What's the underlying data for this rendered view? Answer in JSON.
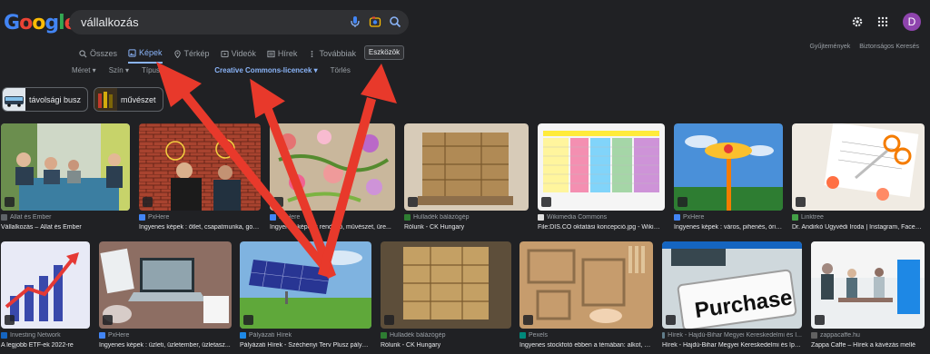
{
  "logo": {
    "text": "Google"
  },
  "search": {
    "query": "vállalkozás"
  },
  "account": {
    "initial": "D"
  },
  "tabs": [
    {
      "label": "Összes",
      "icon": "search-icon"
    },
    {
      "label": "Képek",
      "icon": "image-icon",
      "active": true
    },
    {
      "label": "Térkép",
      "icon": "map-pin-icon"
    },
    {
      "label": "Videók",
      "icon": "video-icon"
    },
    {
      "label": "Hírek",
      "icon": "news-icon"
    },
    {
      "label": "Továbbiak",
      "icon": "more-icon"
    }
  ],
  "tools_label": "Eszközök",
  "right_links": {
    "collections": "Gyűjtemények",
    "safe_search": "Biztonságos Keresés"
  },
  "filters": {
    "size": "Méret",
    "color": "Szín",
    "type": "Típus",
    "license": "Creative Commons-licencek",
    "clear": "Törlés"
  },
  "chips": [
    {
      "label": "távolsági busz"
    },
    {
      "label": "művészet"
    }
  ],
  "results_row1": [
    {
      "source": "Állat és Ember",
      "title": "Vállalkozás – Állat és Ember"
    },
    {
      "source": "PxHere",
      "title": "Ingyenes képek : ötlet, csapatmunka, gon..."
    },
    {
      "source": "PxHere",
      "title": "Ingyenes képek : rendező, művészet, üre..."
    },
    {
      "source": "Hulladék bálázógép",
      "title": "Rólunk - CK Hungary"
    },
    {
      "source": "Wikimedia Commons",
      "title": "File:DIS.CO oktatási koncepció.jpg - Wikime..."
    },
    {
      "source": "PxHere",
      "title": "Ingyenes képek : város, pihenés, óriá..."
    },
    {
      "source": "Linktree",
      "title": "Dr. Andirkó Ügyvédi Iroda | Instagram, Facebo..."
    }
  ],
  "results_row2": [
    {
      "source": "Investing Network",
      "title": "A legjobb ETF-ek 2022-re"
    },
    {
      "source": "PxHere",
      "title": "Ingyenes képek : üzleti, üzletember, üzletasz..."
    },
    {
      "source": "Pályázati Hírek",
      "title": "Pályázati Hírek - Széchenyi Terv Plusz pályáz..."
    },
    {
      "source": "Hulladék bálázógép",
      "title": "Rólunk - CK Hungary"
    },
    {
      "source": "Pexels",
      "title": "Ingyenes stockfotó ebben a témában: alkot, a..."
    },
    {
      "source": "Hírek - Hajdú-Bihar Megyei Kereskedelmi és I...",
      "title": "Hírek - Hajdú-Bihar Megyei Kereskedelmi és Ipar..."
    },
    {
      "source": "zappacaffe.hu",
      "title": "Zappa Caffe – Hírek a kávézás mellé"
    }
  ],
  "image_text": {
    "purchase": "Purchase"
  },
  "colors": {
    "background": "#202124",
    "accent": "#8ab4f8",
    "arrow": "#e8392b"
  }
}
